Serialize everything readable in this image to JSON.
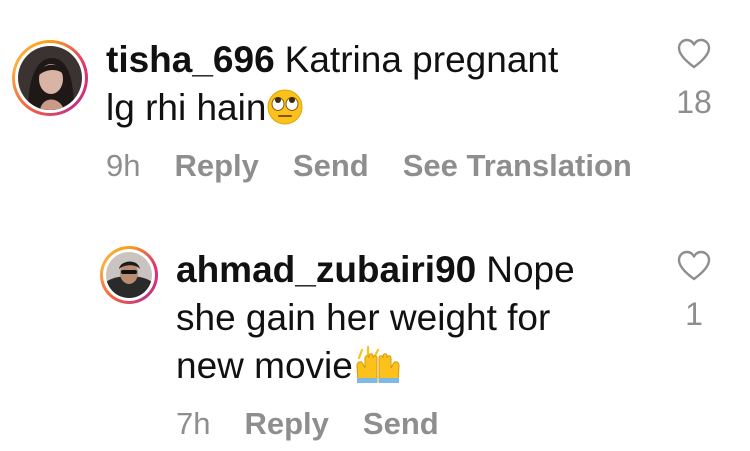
{
  "comments": [
    {
      "username": "tisha_696",
      "text_line1": "Katrina pregnant",
      "text_line2": "lg rhi hain",
      "emoji": "face-with-rolling-eyes",
      "time": "9h",
      "reply_label": "Reply",
      "send_label": "Send",
      "translate_label": "See Translation",
      "like_count": "18"
    },
    {
      "username": "ahmad_zubairi90",
      "text_line1": "Nope",
      "text_line2": "she gain her weight for",
      "text_line3": "new movie",
      "emoji": "raising-hands",
      "time": "7h",
      "reply_label": "Reply",
      "send_label": "Send",
      "like_count": "1"
    }
  ],
  "colors": {
    "meta_text": "#8e8e8e",
    "body_text": "#111111",
    "emoji_yellow": "#fcc21b"
  }
}
